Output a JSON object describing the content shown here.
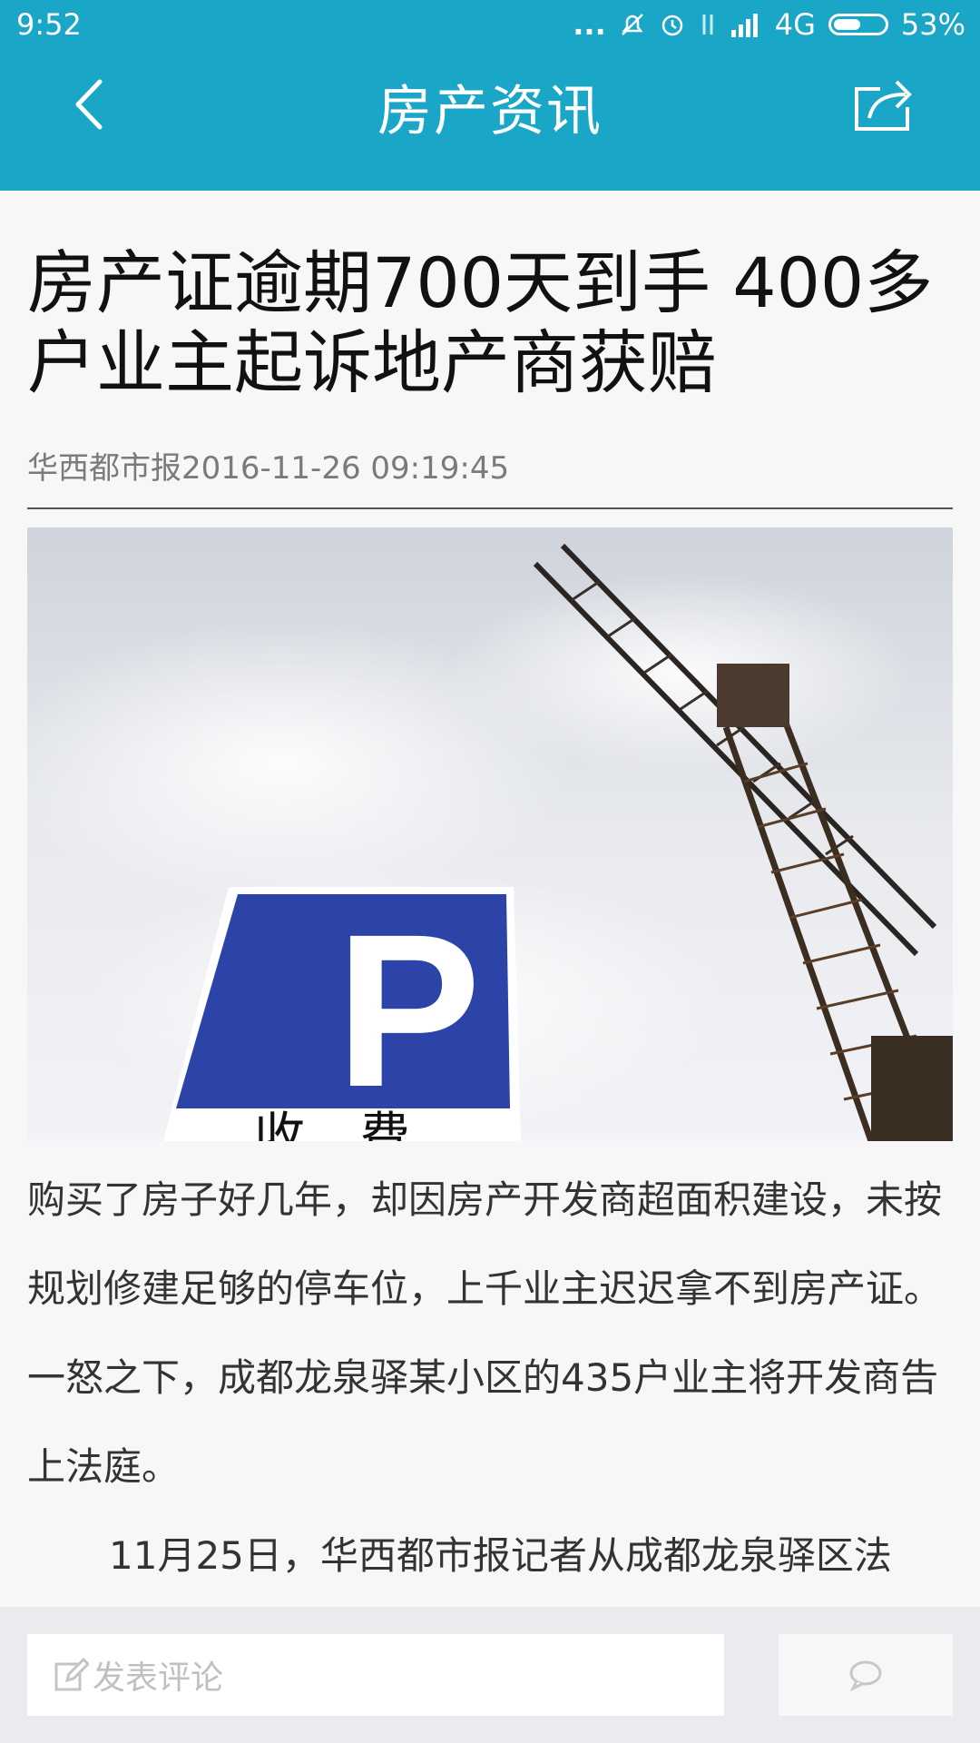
{
  "status_bar": {
    "time": "9:52",
    "dots": "...",
    "network": "4G",
    "battery_text": "53%",
    "battery_level": 0.53
  },
  "header": {
    "title": "房产资讯",
    "back_icon": "chevron-left-icon",
    "share_icon": "share-icon"
  },
  "article": {
    "headline": "房产证逾期700天到手 400多户业主起诉地产商获赔",
    "source_date": "华西都市报2016-11-26 09:19:45",
    "photo": {
      "sign_letter": "P",
      "sign_text": "收费"
    },
    "paragraphs": [
      "购买了房子好几年，却因房产开发商超面积建设，未按规划修建足够的停车位，上千业主迟迟拿不到房产证。一怒之下，成都龙泉驿某小区的435户业主将开发商告上法庭。",
      "11月25日，华西都市报记者从成都龙泉驿区法"
    ]
  },
  "comment_bar": {
    "placeholder": "发表评论",
    "pencil_icon": "edit-icon",
    "comment_icon": "chat-bubble-icon"
  },
  "colors": {
    "header_bg": "#1aa6c6",
    "bar_bg": "#e9ebef"
  }
}
